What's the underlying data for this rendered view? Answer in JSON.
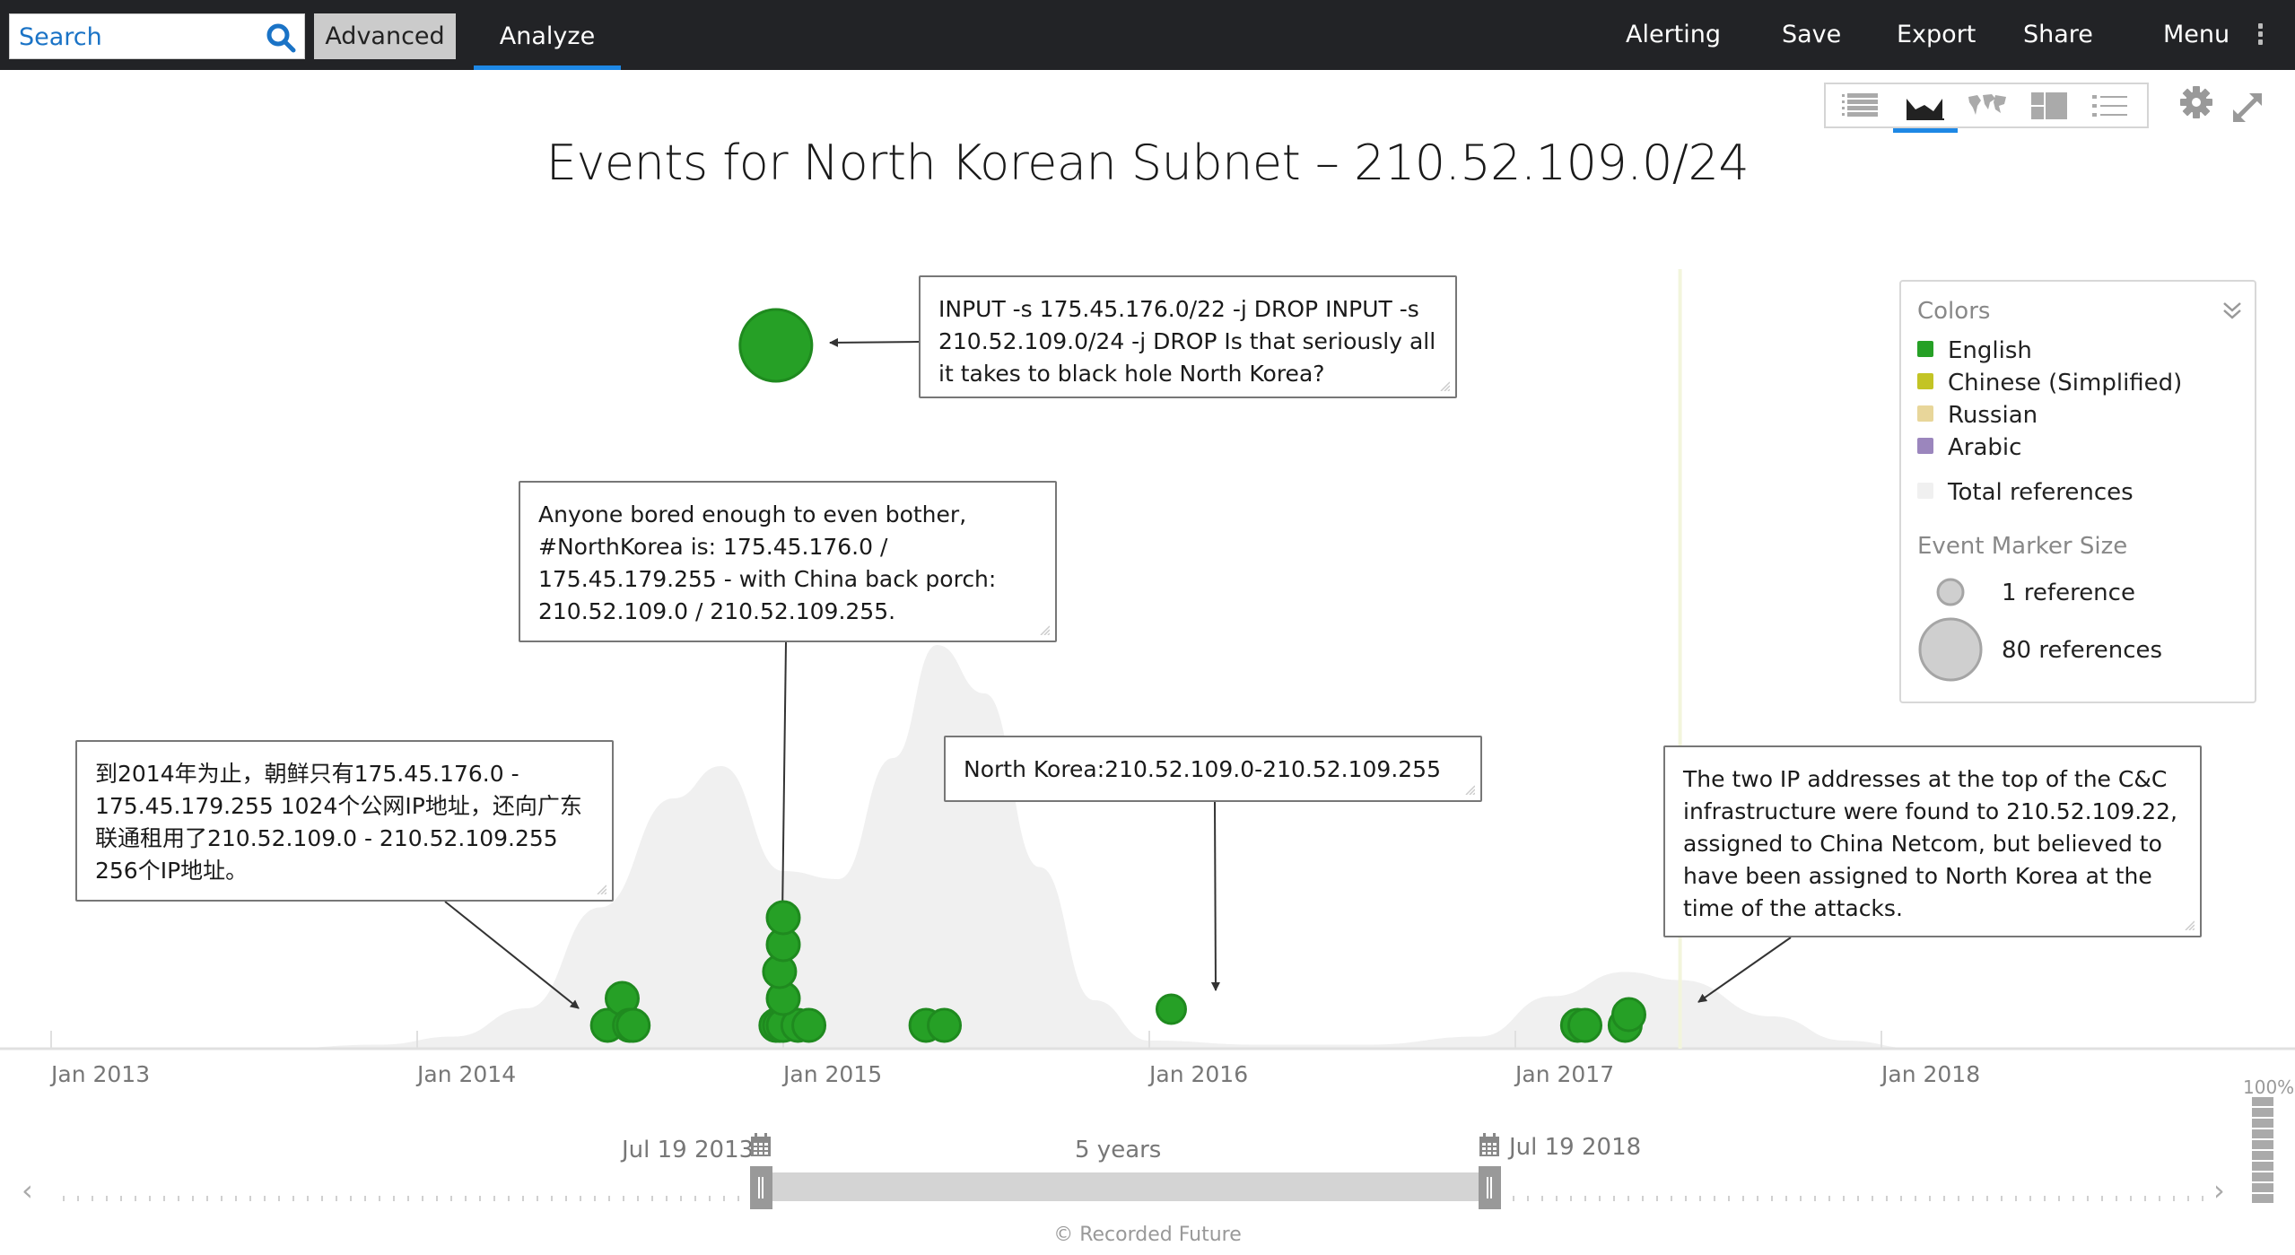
{
  "topbar": {
    "search_placeholder": "Search",
    "advanced_label": "Advanced",
    "analyze_label": "Analyze",
    "alerting_label": "Alerting",
    "save_label": "Save",
    "export_label": "Export",
    "share_label": "Share",
    "menu_label": "Menu"
  },
  "view_switcher": {
    "views": [
      "table-view",
      "timeline-view",
      "map-view",
      "treemap-view",
      "list-view"
    ],
    "active": "timeline-view"
  },
  "colors": {
    "English": "#26a026",
    "Chinese (Simplified)": "#c3c425",
    "Russian": "#e8d69a",
    "Arabic": "#9b86bd",
    "total_area": "#f0f0f0",
    "accent": "#1e88e5",
    "today_line": "#f2f5dc"
  },
  "chart_data": {
    "type": "scatter",
    "title": "Events for North Korean Subnet – 210.52.109.0/24",
    "xlabel": "",
    "ylabel": "",
    "x_ticks": [
      "Jan 2013",
      "Jan 2014",
      "Jan 2015",
      "Jan 2016",
      "Jan 2017",
      "Jan 2018"
    ],
    "x_range": [
      2013.0,
      2018.55
    ],
    "grid": false,
    "legend_position": "top-right",
    "total_references_area": {
      "name": "Total references",
      "x": [
        2013.0,
        2013.6,
        2013.9,
        2014.1,
        2014.3,
        2014.5,
        2014.7,
        2014.83,
        214.0,
        2015.0,
        2015.15,
        2015.3,
        2015.42,
        2015.55,
        2015.7,
        2015.85,
        2016.0,
        2016.3,
        2016.6,
        2016.9,
        2017.1,
        2017.3,
        2017.45,
        2017.7,
        2017.9,
        2018.1
      ],
      "y": [
        0,
        0,
        1,
        3,
        10,
        35,
        62,
        70,
        0,
        44,
        42,
        72,
        100,
        88,
        45,
        12,
        2,
        1,
        1,
        3,
        13,
        19,
        17,
        8,
        2,
        0
      ]
    },
    "events": [
      {
        "x": 2014.52,
        "level": 0,
        "refs": 12,
        "language": "English"
      },
      {
        "x": 2014.56,
        "level": 1,
        "refs": 12,
        "language": "English"
      },
      {
        "x": 2014.58,
        "level": 0,
        "refs": 12,
        "language": "English"
      },
      {
        "x": 2014.59,
        "level": 0,
        "refs": 12,
        "language": "English"
      },
      {
        "x": 2014.98,
        "level": 0,
        "refs": 12,
        "language": "English"
      },
      {
        "x": 2014.99,
        "level": 0,
        "refs": 12,
        "language": "English"
      },
      {
        "x": 2015.0,
        "level": 0,
        "refs": 12,
        "language": "English"
      },
      {
        "x": 2015.04,
        "level": 0,
        "refs": 12,
        "language": "English"
      },
      {
        "x": 2015.07,
        "level": 0,
        "refs": 12,
        "language": "English"
      },
      {
        "x": 2015.0,
        "level": 1,
        "refs": 12,
        "language": "English"
      },
      {
        "x": 2014.99,
        "level": 2,
        "refs": 12,
        "language": "English"
      },
      {
        "x": 2015.0,
        "level": 3,
        "refs": 12,
        "language": "English"
      },
      {
        "x": 2015.0,
        "level": 4,
        "refs": 12,
        "language": "English"
      },
      {
        "x": 2015.39,
        "level": 0,
        "refs": 12,
        "language": "English"
      },
      {
        "x": 2015.44,
        "level": 0,
        "refs": 12,
        "language": "English"
      },
      {
        "x": 2016.06,
        "level": 0.6,
        "refs": 8,
        "language": "English"
      },
      {
        "x": 2017.17,
        "level": 0,
        "refs": 12,
        "language": "English"
      },
      {
        "x": 2017.19,
        "level": 0,
        "refs": 12,
        "language": "English"
      },
      {
        "x": 2017.3,
        "level": 0,
        "refs": 12,
        "language": "English"
      },
      {
        "x": 2017.31,
        "level": 0.4,
        "refs": 12,
        "language": "English"
      },
      {
        "x": 2014.98,
        "level": "top",
        "refs": 45,
        "language": "English"
      }
    ],
    "annotations": [
      {
        "id": "top",
        "text": "INPUT -s 175.45.176.0/22 -j DROP INPUT -s 210.52.109.0/24 -j DROP Is that seriously all it takes to black hole North Korea?"
      },
      {
        "id": "bored",
        "text": "Anyone bored enough to even bother, #NorthKorea is: 175.45.176.0 / 175.45.179.255 - with China back porch: 210.52.109.0 / 210.52.109.255."
      },
      {
        "id": "chinese",
        "text": "到2014年为止，朝鲜只有175.45.176.0 - 175.45.179.255 1024个公网IP地址，还向广东联通租用了210.52.109.0 - 210.52.109.255 256个IP地址。"
      },
      {
        "id": "nk",
        "text": "North Korea:210.52.109.0-210.52.109.255"
      },
      {
        "id": "cc",
        "text": "The two IP addresses at the top of the C&C infrastructure were found to 210.52.109.22, assigned to China Netcom, but believed to have been assigned to North Korea at the time of the attacks."
      }
    ],
    "today_marker_x": 2017.45
  },
  "legend": {
    "colors_heading": "Colors",
    "items": [
      {
        "label": "English",
        "color": "#26a026"
      },
      {
        "label": "Chinese (Simplified)",
        "color": "#c3c425"
      },
      {
        "label": "Russian",
        "color": "#e8d69a"
      },
      {
        "label": "Arabic",
        "color": "#9b86bd"
      }
    ],
    "total_label": "Total references",
    "size_heading": "Event Marker Size",
    "size_small_label": "1 reference",
    "size_large_label": "80 references"
  },
  "time_range": {
    "start_label": "Jul 19 2013",
    "end_label": "Jul 19 2018",
    "span_label": "5 years",
    "zoom_percent": "100%"
  },
  "footer": {
    "copyright": "© Recorded Future"
  }
}
